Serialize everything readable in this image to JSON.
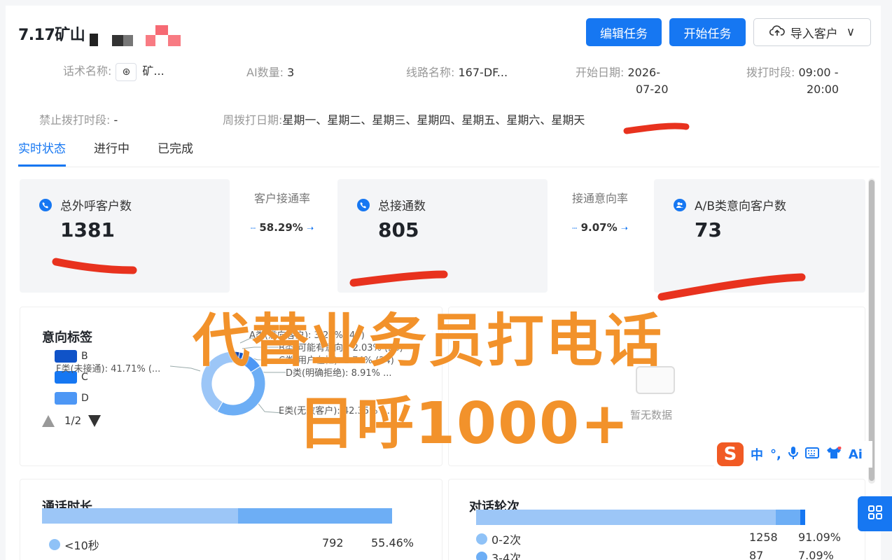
{
  "header": {
    "task_title": "7.17矿山",
    "buttons": {
      "edit": "编辑任务",
      "start": "开始任务",
      "import": "导入客户",
      "import_chevron": "∨"
    }
  },
  "meta": {
    "script_label": "话术名称:",
    "script_value": "矿...",
    "ai_label": "AI数量:",
    "ai_value": "3",
    "line_label": "线路名称:",
    "line_value": "167-DF...",
    "start_label": "开始日期:",
    "start_value_1": "2026-",
    "start_value_2": "07-20",
    "dial_label": "拨打时段:",
    "dial_value_1": "09:00 -",
    "dial_value_2": "20:00",
    "forbid_label": "禁止拨打时段:",
    "forbid_value": "-",
    "week_label": "周拨打日期:",
    "week_value": "星期一、星期二、星期三、星期四、星期五、星期六、星期天"
  },
  "tabs": [
    {
      "label": "实时状态",
      "active": true
    },
    {
      "label": "进行中",
      "active": false
    },
    {
      "label": "已完成",
      "active": false
    }
  ],
  "stats": {
    "total_calls": {
      "label": "总外呼客户数",
      "value": "1381"
    },
    "connect_rate": {
      "label": "客户接通率",
      "value": "58.29%"
    },
    "total_connected": {
      "label": "总接通数",
      "value": "805"
    },
    "intent_rate": {
      "label": "接通意向率",
      "value": "9.07%"
    },
    "ab_customers": {
      "label": "A/B类意向客户数",
      "value": "73"
    }
  },
  "intent_panel": {
    "title": "意向标签",
    "legend": [
      {
        "label": "B",
        "color": "#1053c8"
      },
      {
        "label": "C",
        "color": "#1677f2"
      },
      {
        "label": "D",
        "color": "#4d97f5"
      }
    ],
    "pager": "1/2",
    "slices": [
      {
        "label": "A类(意向客户): 3.26% (45)"
      },
      {
        "label": "B类(可能有意向): 2.03% (28)"
      },
      {
        "label": "C类(用户在忙): 1.74% (24)"
      },
      {
        "label": "D类(明确拒绝): 8.91% ..."
      },
      {
        "label": "E类(无效客户): 42.35% (..."
      },
      {
        "label": "F类(未接通): 41.71% (..."
      }
    ]
  },
  "empty_panel": {
    "text": "暂无数据"
  },
  "duration_panel": {
    "title": "通话时长",
    "rows": [
      {
        "label": "<10秒",
        "count": "792",
        "pct": "55.46%"
      }
    ]
  },
  "turns_panel": {
    "title": "对话轮次",
    "rows": [
      {
        "label": "0-2次",
        "count": "1258",
        "pct": "91.09%"
      },
      {
        "label": "3-4次",
        "count": "87",
        "pct": "7.09%"
      }
    ]
  },
  "overlay": {
    "line1": "代替业务员打电话",
    "line2": "日呼1000+"
  },
  "ime": {
    "logo": "S",
    "mode": "中",
    "punct": "°,",
    "ai": "Ai"
  },
  "colors": {
    "primary": "#1677f2",
    "promo": "#f2922b",
    "scribble": "#e8321e"
  }
}
